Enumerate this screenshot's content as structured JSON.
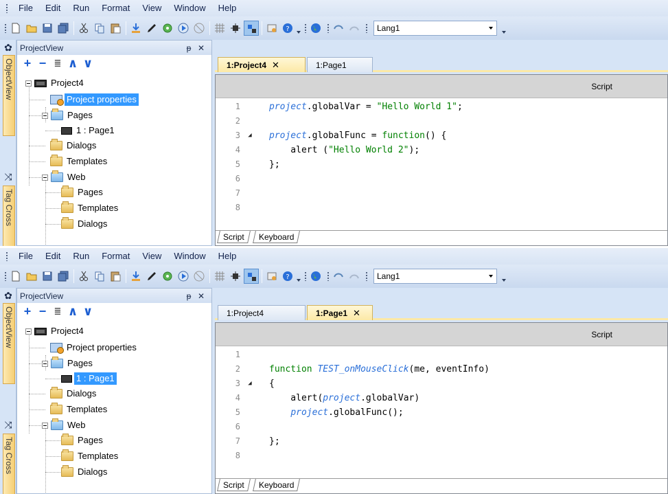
{
  "menu": [
    "File",
    "Edit",
    "Run",
    "Format",
    "View",
    "Window",
    "Help"
  ],
  "toolbar": {
    "language": "Lang1",
    "icons": [
      "new-icon",
      "open-icon",
      "save-icon",
      "save-all-icon",
      "cut-icon",
      "copy-icon",
      "paste-icon",
      "download-icon",
      "pen-icon",
      "gear-icon",
      "play-icon",
      "stop-icon",
      "grid-icon",
      "pin-icon",
      "layout-icon",
      "settings-icon",
      "help-icon",
      "globe-icon",
      "undo-icon",
      "redo-icon"
    ]
  },
  "side": {
    "tab1": "ObjectView",
    "tab2": "Tag Cross"
  },
  "projectview": {
    "title": "ProjectView",
    "pin": "ᵽ",
    "close": "✕"
  },
  "colors": {
    "accent": "#3399ff",
    "active_tab": "#fce9a6",
    "keyword": "#008000",
    "project": "#2a6fd8"
  },
  "panel1": {
    "tabs": [
      {
        "label": "1:Project4",
        "close": "✕"
      },
      {
        "label": "1:Page1"
      }
    ],
    "active_tab": 0,
    "tree": [
      "Project4",
      "Project properties",
      "Pages",
      "1 : Page1",
      "Dialogs",
      "Templates",
      "Web",
      "Pages",
      "Templates",
      "Dialogs"
    ],
    "selected": 1,
    "script_header": "Script",
    "lines": [
      {
        "n": "1",
        "parts": [
          [
            "pj",
            "project"
          ],
          [
            "",
            "."
          ],
          [
            "",
            "globalVar = "
          ],
          [
            "str",
            "\"Hello World 1\""
          ],
          [
            "",
            ";"
          ]
        ]
      },
      {
        "n": "2",
        "parts": []
      },
      {
        "n": "3",
        "fold": "◢",
        "parts": [
          [
            "pj",
            "project"
          ],
          [
            "",
            ".globalFunc = "
          ],
          [
            "kw",
            "function"
          ],
          [
            "",
            "() {"
          ]
        ]
      },
      {
        "n": "4",
        "parts": [
          [
            "",
            "    alert ("
          ],
          [
            "str",
            "\"Hello World 2\""
          ],
          [
            "",
            ");"
          ]
        ]
      },
      {
        "n": "5",
        "parts": [
          [
            "",
            "};"
          ]
        ]
      },
      {
        "n": "6",
        "parts": []
      },
      {
        "n": "7",
        "parts": []
      },
      {
        "n": "8",
        "parts": []
      }
    ],
    "bottom_tabs": [
      "Script",
      "Keyboard"
    ]
  },
  "panel2": {
    "tabs": [
      {
        "label": "1:Project4"
      },
      {
        "label": "1:Page1",
        "close": "✕"
      }
    ],
    "active_tab": 1,
    "tree": [
      "Project4",
      "Project properties",
      "Pages",
      "1 : Page1",
      "Dialogs",
      "Templates",
      "Web",
      "Pages",
      "Templates",
      "Dialogs"
    ],
    "selected": 3,
    "script_header": "Script",
    "lines": [
      {
        "n": "1",
        "parts": []
      },
      {
        "n": "2",
        "parts": [
          [
            "kw",
            "function "
          ],
          [
            "fn",
            "TEST_onMouseClick"
          ],
          [
            "",
            "(me, eventInfo)"
          ]
        ]
      },
      {
        "n": "3",
        "fold": "◢",
        "parts": [
          [
            "",
            "{"
          ]
        ]
      },
      {
        "n": "4",
        "parts": [
          [
            "",
            "    alert("
          ],
          [
            "pj",
            "project"
          ],
          [
            "",
            ".globalVar)"
          ]
        ]
      },
      {
        "n": "5",
        "parts": [
          [
            "",
            "    "
          ],
          [
            "pj",
            "project"
          ],
          [
            "",
            ".globalFunc();"
          ]
        ]
      },
      {
        "n": "6",
        "parts": []
      },
      {
        "n": "7",
        "parts": [
          [
            "",
            "};"
          ]
        ]
      },
      {
        "n": "8",
        "parts": []
      }
    ],
    "bottom_tabs": [
      "Script",
      "Keyboard"
    ]
  }
}
